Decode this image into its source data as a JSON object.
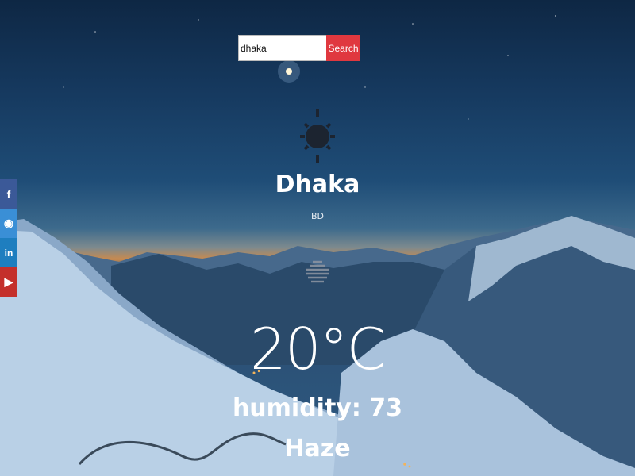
{
  "search": {
    "value": "dhaka",
    "button_label": "Search"
  },
  "social": [
    {
      "icon": "facebook-icon",
      "glyph": "f",
      "color": "#3b5998"
    },
    {
      "icon": "github-icon",
      "glyph": "◉",
      "color": "#3a8fd6"
    },
    {
      "icon": "linkedin-icon",
      "glyph": "in",
      "color": "#1e7ebf"
    },
    {
      "icon": "youtube-icon",
      "glyph": "▶",
      "color": "#c4302b"
    }
  ],
  "weather": {
    "icon": "sun-icon",
    "city": "Dhaka",
    "country": "BD",
    "condition_icon": "haze-icon",
    "temperature": "20°C",
    "humidity": "humidity: 73",
    "condition": "Haze"
  },
  "colors": {
    "accent": "#e0383f"
  }
}
